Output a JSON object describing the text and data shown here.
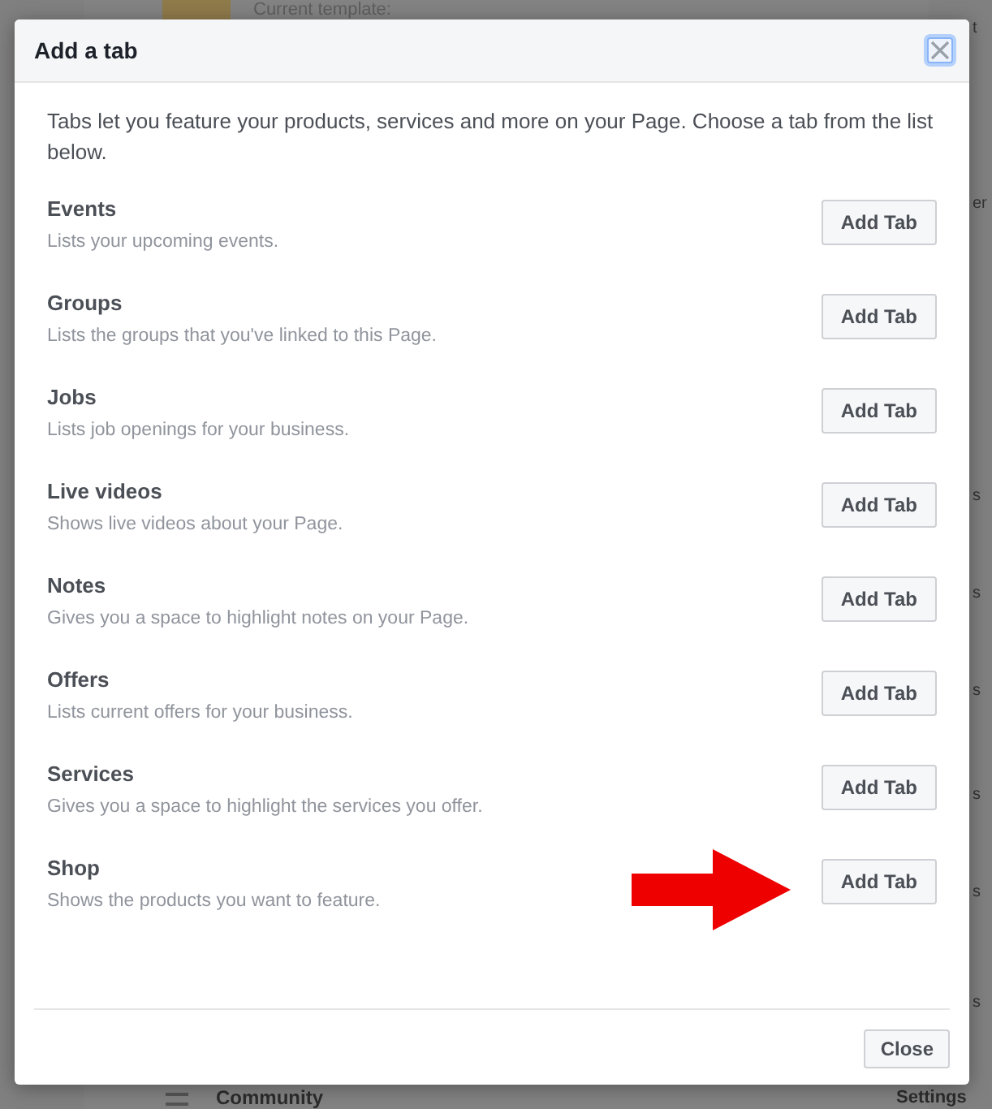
{
  "background": {
    "template_label": "Current template:",
    "section_title": "Community",
    "settings_link": "Settings",
    "edge_fragments": [
      "t",
      "er",
      "s",
      "s",
      "s",
      "s",
      "s",
      "s"
    ]
  },
  "dialog": {
    "title": "Add a tab",
    "intro": "Tabs let you feature your products, services and more on your Page. Choose a tab from the list below.",
    "tabs": [
      {
        "name": "Events",
        "description": "Lists your upcoming events.",
        "button": "Add Tab",
        "highlighted": false
      },
      {
        "name": "Groups",
        "description": "Lists the groups that you've linked to this Page.",
        "button": "Add Tab",
        "highlighted": false
      },
      {
        "name": "Jobs",
        "description": "Lists job openings for your business.",
        "button": "Add Tab",
        "highlighted": false
      },
      {
        "name": "Live videos",
        "description": "Shows live videos about your Page.",
        "button": "Add Tab",
        "highlighted": false
      },
      {
        "name": "Notes",
        "description": "Gives you a space to highlight notes on your Page.",
        "button": "Add Tab",
        "highlighted": false
      },
      {
        "name": "Offers",
        "description": "Lists current offers for your business.",
        "button": "Add Tab",
        "highlighted": false
      },
      {
        "name": "Services",
        "description": "Gives you a space to highlight the services you offer.",
        "button": "Add Tab",
        "highlighted": false
      },
      {
        "name": "Shop",
        "description": "Shows the products you want to feature.",
        "button": "Add Tab",
        "highlighted": true
      }
    ],
    "close_button": "Close"
  }
}
